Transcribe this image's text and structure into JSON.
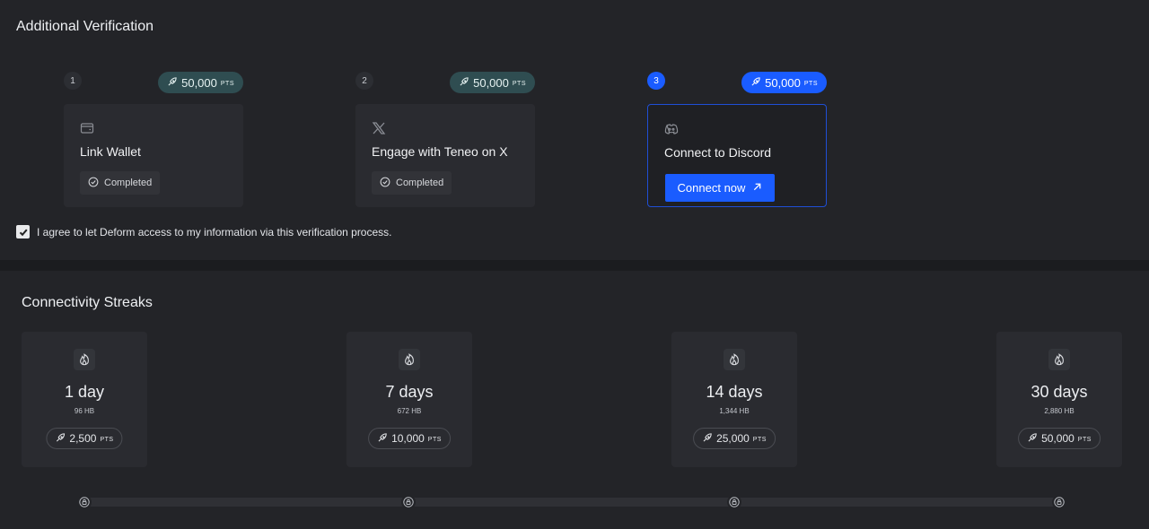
{
  "verification": {
    "title": "Additional Verification",
    "steps": [
      {
        "number": "1",
        "points": "50,000",
        "unit": "PTS",
        "icon": "wallet-icon",
        "title": "Link Wallet",
        "status": "Completed"
      },
      {
        "number": "2",
        "points": "50,000",
        "unit": "PTS",
        "icon": "x-logo-icon",
        "title": "Engage with Teneo on X",
        "status": "Completed"
      },
      {
        "number": "3",
        "points": "50,000",
        "unit": "PTS",
        "icon": "discord-icon",
        "title": "Connect to Discord",
        "button": "Connect now"
      }
    ],
    "agree": {
      "checked": true,
      "label": "I agree to let Deform access to my information via this verification process."
    }
  },
  "streaks": {
    "title": "Connectivity Streaks",
    "items": [
      {
        "days": "1 day",
        "hb": "96 HB",
        "points": "2,500",
        "unit": "PTS"
      },
      {
        "days": "7 days",
        "hb": "672 HB",
        "points": "10,000",
        "unit": "PTS"
      },
      {
        "days": "14 days",
        "hb": "1,344 HB",
        "points": "25,000",
        "unit": "PTS"
      },
      {
        "days": "30 days",
        "hb": "2,880 HB",
        "points": "50,000",
        "unit": "PTS"
      }
    ],
    "progress": 0
  },
  "colors": {
    "accent": "#1a5cff",
    "badge": "#2f4d51",
    "background": "#232428",
    "card": "#2a2b30"
  },
  "icons": {
    "points": "rocket-icon",
    "streak": "fire-icon",
    "completed": "check-circle-icon",
    "node": "lock-icon",
    "external": "arrow-up-right-icon"
  }
}
